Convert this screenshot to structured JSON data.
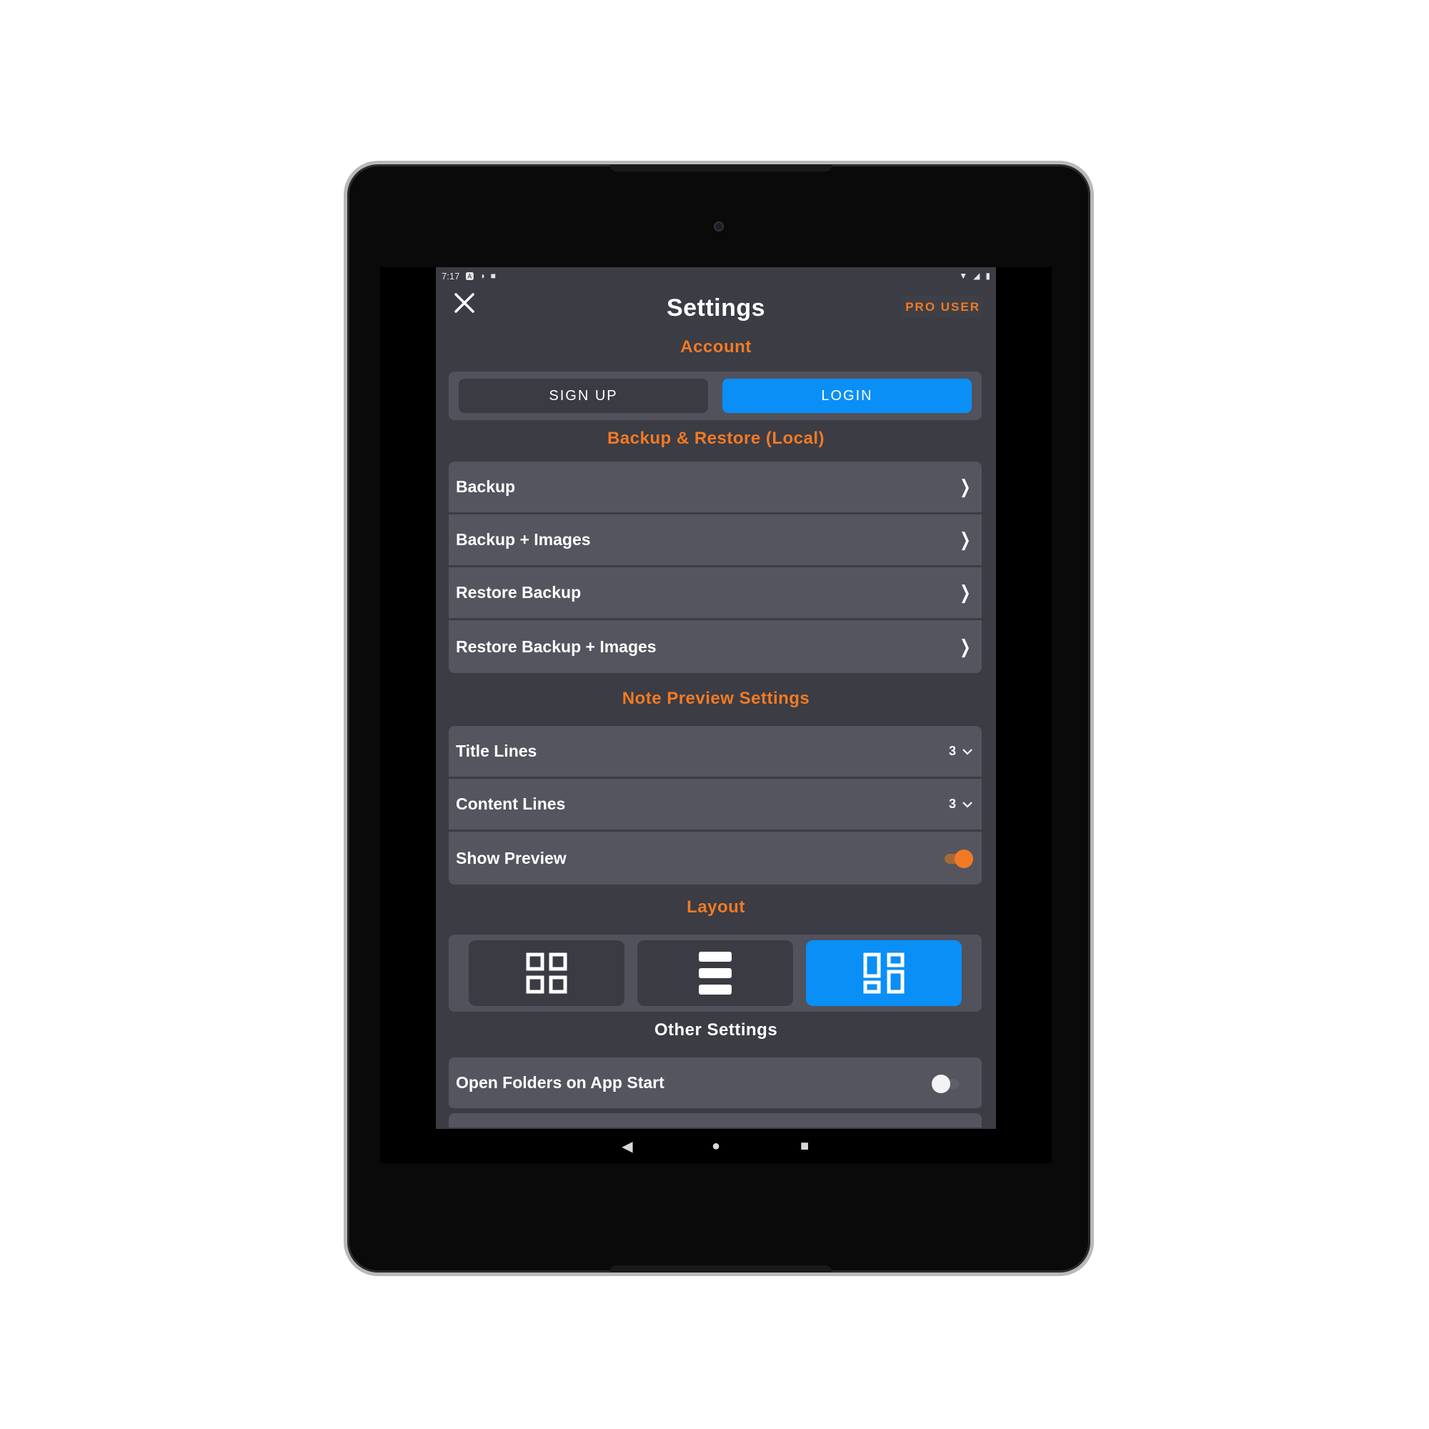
{
  "status_bar": {
    "time": "7:17",
    "left_icons": [
      "a-icon",
      "record-icon",
      "sd-card-icon"
    ],
    "right_icons": [
      "wifi-icon",
      "signal-icon",
      "battery-icon"
    ]
  },
  "header": {
    "title": "Settings",
    "pro_label": "PRO USER"
  },
  "account": {
    "section_title": "Account",
    "signup_label": "SIGN UP",
    "login_label": "LOGIN"
  },
  "backup": {
    "section_title": "Backup & Restore (Local)",
    "items": [
      {
        "label": "Backup"
      },
      {
        "label": "Backup + Images"
      },
      {
        "label": "Restore Backup"
      },
      {
        "label": "Restore Backup + Images"
      }
    ]
  },
  "preview": {
    "section_title": "Note Preview Settings",
    "title_lines_label": "Title Lines",
    "title_lines_value": "3",
    "content_lines_label": "Content Lines",
    "content_lines_value": "3",
    "show_preview_label": "Show Preview",
    "show_preview_on": true
  },
  "layout": {
    "section_title": "Layout",
    "options": [
      "grid-icon",
      "list-icon",
      "staggered-grid-icon"
    ],
    "selected": "staggered-grid-icon"
  },
  "other": {
    "section_title": "Other Settings",
    "open_folders_label": "Open Folders on App Start",
    "open_folders_on": false
  },
  "colors": {
    "accent": "#f27a24",
    "primary": "#0a8ff7",
    "background": "#3b3c44",
    "row": "#54555e"
  }
}
